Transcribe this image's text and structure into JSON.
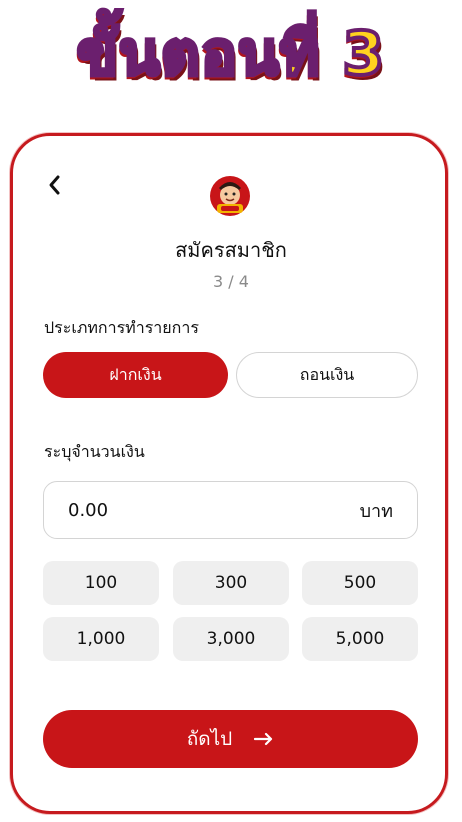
{
  "header": {
    "step_title": "ขั้นตอนที่ 3"
  },
  "screen": {
    "title": "สมัครสมาชิก",
    "step_count": "3 / 4",
    "back_icon": "chevron-left-icon",
    "avatar_icon": "mascot-avatar-icon"
  },
  "transaction": {
    "label": "ประเภทการทำรายการ",
    "options": [
      {
        "label": "ฝากเงิน",
        "selected": true
      },
      {
        "label": "ถอนเงิน",
        "selected": false
      }
    ]
  },
  "amount": {
    "label": "ระบุจำนวนเงิน",
    "value": "0.00",
    "unit": "บาท"
  },
  "quick_amounts": [
    "100",
    "300",
    "500",
    "1,000",
    "3,000",
    "5,000"
  ],
  "next_button": {
    "label": "ถัดไป",
    "icon": "arrow-right-icon"
  },
  "colors": {
    "accent": "#C81518",
    "title_fill": "#FFD21F",
    "title_stroke": "#6B1F6E"
  }
}
